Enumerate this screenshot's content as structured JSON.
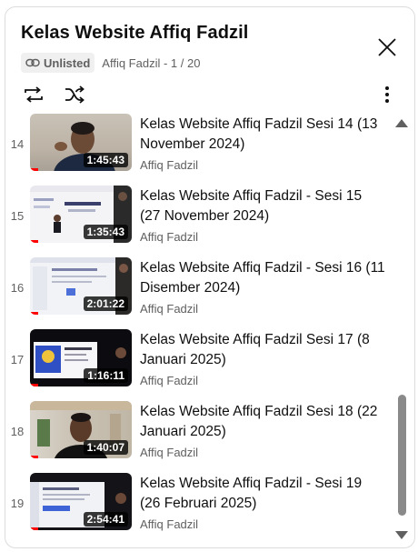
{
  "header": {
    "title": "Kelas Website Affiq Fadzil",
    "privacy": "Unlisted",
    "owner_position": "Affiq Fadzil - 1 / 20"
  },
  "icons": {
    "close": "close-icon",
    "loop": "loop-icon",
    "shuffle": "shuffle-icon",
    "more": "more-vert-icon",
    "link": "link-icon"
  },
  "colors": {
    "progress": "#ff0000",
    "muted": "#606060"
  },
  "videos": [
    {
      "index": "14",
      "title": "Kelas Website Affiq Fadzil Sesi 14 (13 November 2024)",
      "channel": "Affiq Fadzil",
      "duration": "1:45:43",
      "watched_fraction": 0.08
    },
    {
      "index": "15",
      "title": "Kelas Website Affiq Fadzil - Sesi 15 (27 November 2024)",
      "channel": "Affiq Fadzil",
      "duration": "1:35:43",
      "watched_fraction": 0.08
    },
    {
      "index": "16",
      "title": "Kelas Website Affiq Fadzil - Sesi 16 (11 Disember 2024)",
      "channel": "Affiq Fadzil",
      "duration": "2:01:22",
      "watched_fraction": 0.08
    },
    {
      "index": "17",
      "title": "Kelas Website Affiq Fadzil Sesi 17 (8 Januari 2025)",
      "channel": "Affiq Fadzil",
      "duration": "1:16:11",
      "watched_fraction": 0.08
    },
    {
      "index": "18",
      "title": "Kelas Website Affiq Fadzil Sesi 18 (22 Januari 2025)",
      "channel": "Affiq Fadzil",
      "duration": "1:40:07",
      "watched_fraction": 0.08
    },
    {
      "index": "19",
      "title": "Kelas Website Affiq Fadzil - Sesi 19 (26 Februari 2025)",
      "channel": "Affiq Fadzil",
      "duration": "2:54:41",
      "watched_fraction": 0.08
    }
  ]
}
